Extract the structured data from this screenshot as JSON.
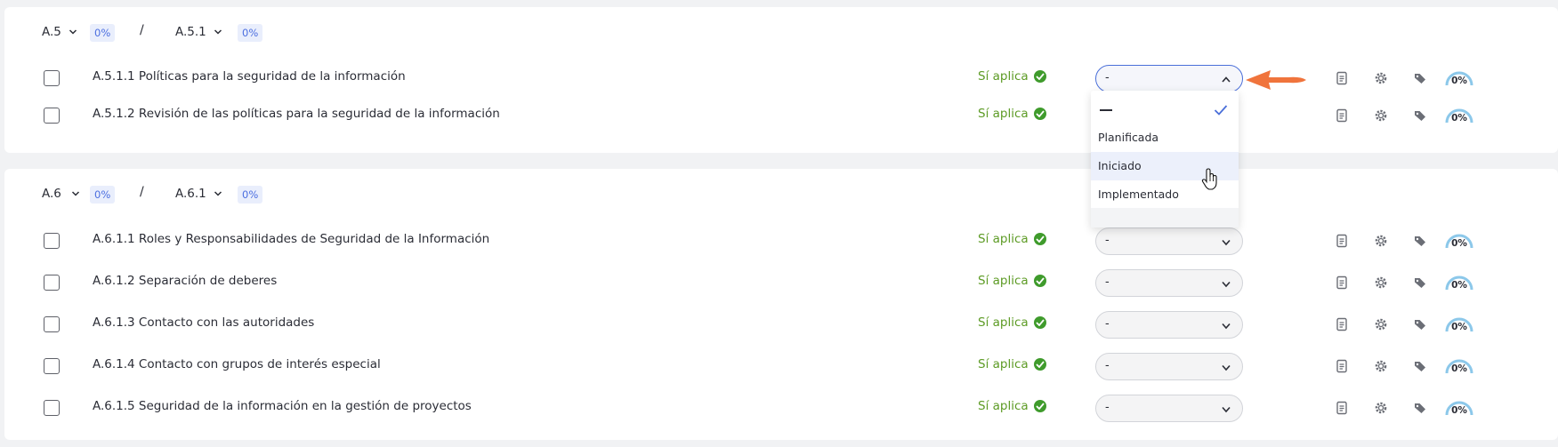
{
  "sections": [
    {
      "code": "A.5",
      "pct": "0%",
      "separator": "/",
      "sub_code": "A.5.1",
      "sub_pct": "0%",
      "rows": [
        {
          "title": "A.5.1.1 Políticas para la seguridad de la información",
          "applies": "Sí aplica",
          "status": "-",
          "progress": "0%",
          "open": true
        },
        {
          "title": "A.5.1.2 Revisión de las políticas para la seguridad de la información",
          "applies": "Sí aplica",
          "status": "-",
          "progress": "0%",
          "open": false
        }
      ]
    },
    {
      "code": "A.6",
      "pct": "0%",
      "separator": "/",
      "sub_code": "A.6.1",
      "sub_pct": "0%",
      "rows": [
        {
          "title": "A.6.1.1 Roles y Responsabilidades de Seguridad de la Información",
          "applies": "Sí aplica",
          "status": "-",
          "progress": "0%",
          "open": false
        },
        {
          "title": "A.6.1.2 Separación de deberes",
          "applies": "Sí aplica",
          "status": "-",
          "progress": "0%",
          "open": false
        },
        {
          "title": "A.6.1.3 Contacto con las autoridades",
          "applies": "Sí aplica",
          "status": "-",
          "progress": "0%",
          "open": false
        },
        {
          "title": "A.6.1.4 Contacto con grupos de interés especial",
          "applies": "Sí aplica",
          "status": "-",
          "progress": "0%",
          "open": false
        },
        {
          "title": "A.6.1.5 Seguridad de la información en la gestión de proyectos",
          "applies": "Sí aplica",
          "status": "-",
          "progress": "0%",
          "open": false
        }
      ]
    }
  ],
  "dropdown": {
    "selected_option": "—",
    "options": [
      "Planificada",
      "Iniciado",
      "Implementado"
    ],
    "hovered_option": "Iniciado"
  },
  "icons": {
    "document": "document-icon",
    "settings": "gear-icon",
    "tags": "tags-icon",
    "applies": "check-circle-icon",
    "progress_fraction": 0.0
  },
  "colors": {
    "accent": "#4a6fd9",
    "applies_green": "#5d9b25",
    "arrow_orange": "#f0743c",
    "pct_bg": "#e9eefc",
    "gauge": "#8cc8ea"
  }
}
